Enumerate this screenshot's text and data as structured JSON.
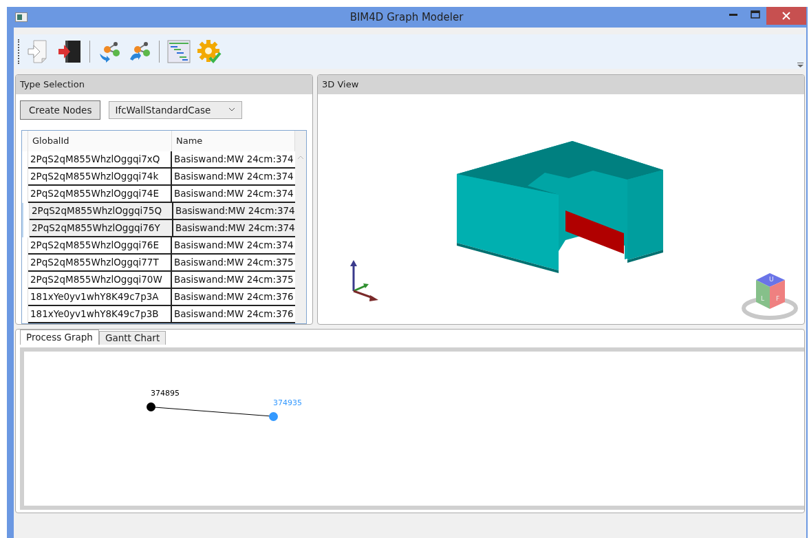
{
  "window": {
    "title": "BIM4D Graph Modeler"
  },
  "type_selection": {
    "title": "Type Selection",
    "create_button": "Create Nodes",
    "type_dropdown": {
      "value": "IfcWallStandardCase"
    },
    "table": {
      "columns": [
        "GlobalId",
        "Name"
      ],
      "rows": [
        {
          "cells": [
            "2PqS2qM855WhzlOggqi7xQ",
            "Basiswand:MW 24cm:374"
          ],
          "selected": false
        },
        {
          "cells": [
            "2PqS2qM855WhzlOggqi74k",
            "Basiswand:MW 24cm:374"
          ],
          "selected": false
        },
        {
          "cells": [
            "2PqS2qM855WhzlOggqi74E",
            "Basiswand:MW 24cm:374"
          ],
          "selected": false
        },
        {
          "cells": [
            "2PqS2qM855WhzlOggqi75Q",
            "Basiswand:MW 24cm:374"
          ],
          "selected": true
        },
        {
          "cells": [
            "2PqS2qM855WhzlOggqi76Y",
            "Basiswand:MW 24cm:374"
          ],
          "selected": true
        },
        {
          "cells": [
            "2PqS2qM855WhzlOggqi76E",
            "Basiswand:MW 24cm:374"
          ],
          "selected": false
        },
        {
          "cells": [
            "2PqS2qM855WhzlOggqi77T",
            "Basiswand:MW 24cm:375"
          ],
          "selected": false
        },
        {
          "cells": [
            "2PqS2qM855WhzlOggqi70W",
            "Basiswand:MW 24cm:375"
          ],
          "selected": false
        },
        {
          "cells": [
            "181xYe0yv1whY8K49c7p3A",
            "Basiswand:MW 24cm:376"
          ],
          "selected": false
        },
        {
          "cells": [
            "181xYe0yv1whY8K49c7p3B",
            "Basiswand:MW 24cm:376"
          ],
          "selected": false
        }
      ]
    }
  },
  "view_3d": {
    "title": "3D View",
    "view_cube": {
      "faces": [
        "U",
        "L",
        "F"
      ]
    }
  },
  "tabs": [
    {
      "label": "Process Graph",
      "selected": true
    },
    {
      "label": "Gantt Chart",
      "selected": false
    }
  ],
  "graph": {
    "nodes": [
      {
        "label": "374895",
        "color": "#000000"
      },
      {
        "label": "374935",
        "color": "#3399ff"
      }
    ]
  }
}
